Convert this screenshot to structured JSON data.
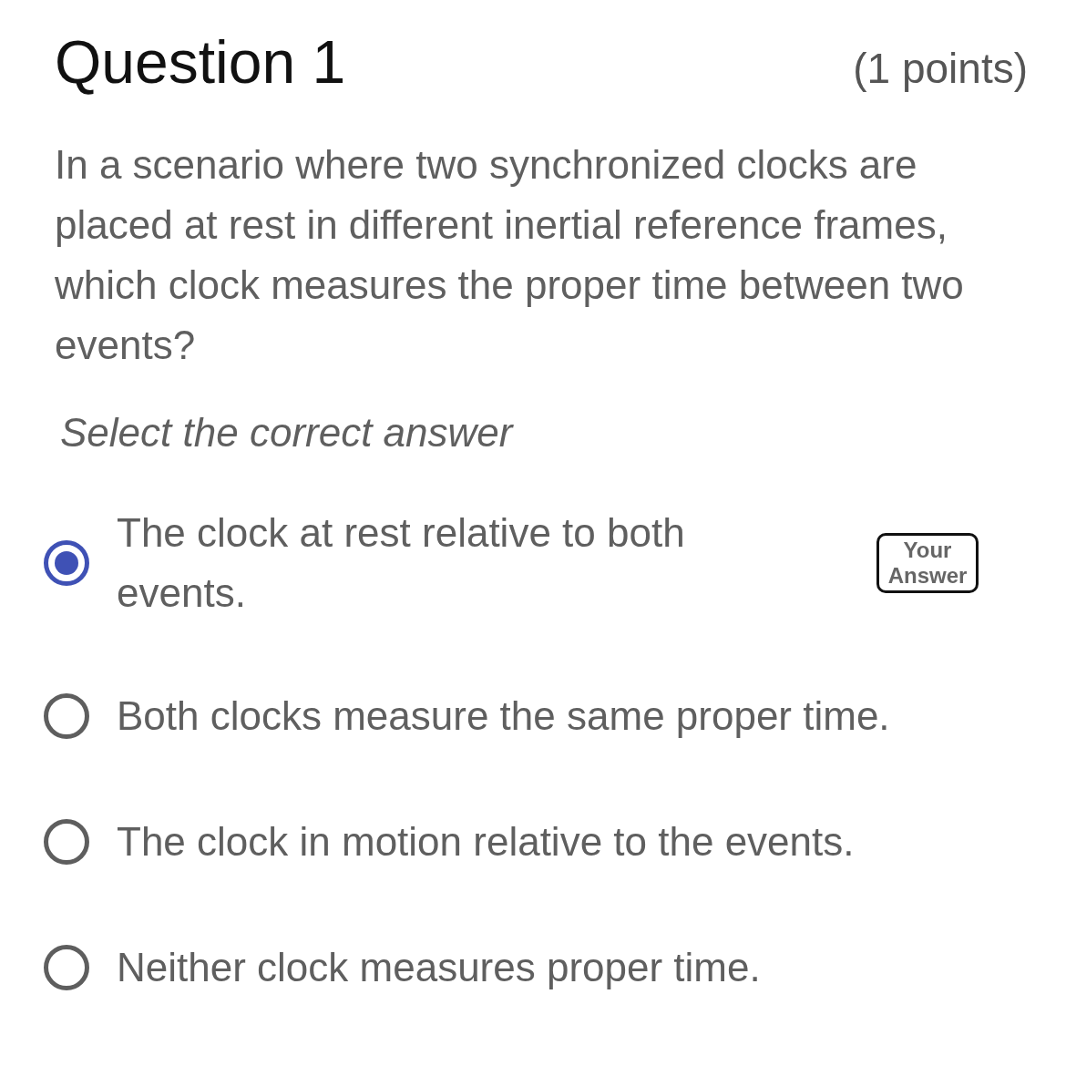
{
  "question": {
    "title": "Question 1",
    "points": "(1 points)",
    "text": "In a scenario where two synchronized clocks are placed at rest in different inertial reference frames, which clock measures the proper time between two events?",
    "instruction": "Select the correct answer"
  },
  "options": [
    {
      "label": "The clock at rest relative to both events.",
      "selected": true,
      "badge": "Your Answer"
    },
    {
      "label": "Both clocks measure the same proper time.",
      "selected": false
    },
    {
      "label": "The clock in motion relative to the events.",
      "selected": false
    },
    {
      "label": "Neither clock measures proper time.",
      "selected": false
    }
  ]
}
